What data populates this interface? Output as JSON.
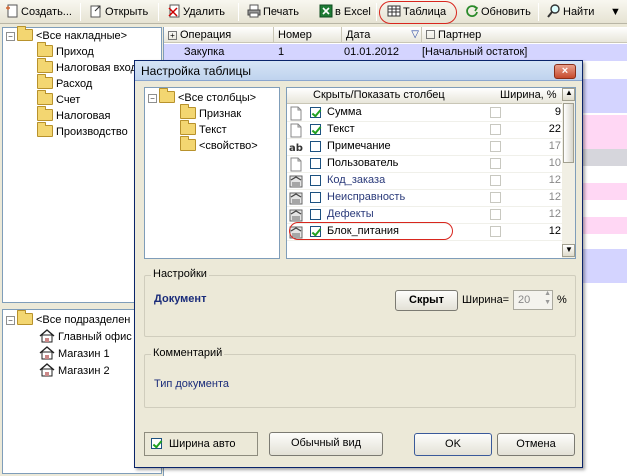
{
  "toolbar": {
    "items": [
      {
        "label": "Создать...",
        "icon": "new-doc-icon"
      },
      {
        "label": "Открыть",
        "icon": "open-icon"
      },
      {
        "label": "Удалить",
        "icon": "delete-icon"
      },
      {
        "label": "Печать",
        "icon": "print-icon"
      },
      {
        "label": "в Excel",
        "icon": "excel-icon"
      },
      {
        "label": "Таблица",
        "icon": "table-icon"
      },
      {
        "label": "Обновить",
        "icon": "refresh-icon"
      },
      {
        "label": "Найти",
        "icon": "find-icon"
      }
    ]
  },
  "left_tree": {
    "root": "<Все накладные>",
    "items": [
      "Приход",
      "Налоговая вход",
      "Расход",
      "Счет",
      "Налоговая",
      "Производство"
    ]
  },
  "dept_tree": {
    "root": "<Все подразделен",
    "items": [
      "Главный офис",
      "Магазин 1",
      "Магазин 2"
    ]
  },
  "grid": {
    "headers": [
      "Операция",
      "Номер",
      "Дата",
      "Партнер"
    ],
    "first_row": [
      "Закупка",
      "1",
      "01.01.2012",
      "[Начальный остаток]"
    ]
  },
  "dialog": {
    "title": "Настройка таблицы",
    "close": "×",
    "tree_root": "<Все столбцы>",
    "tree_items": [
      "Признак",
      "Текст",
      "<свойство>"
    ],
    "columns_header": {
      "show": "Скрыть/Показать столбец",
      "width": "Ширина, %"
    },
    "columns": [
      {
        "name": "Сумма",
        "checked": true,
        "enabled": true,
        "width": "9",
        "icon": "doc-icon"
      },
      {
        "name": "Текст",
        "checked": true,
        "enabled": true,
        "width": "22",
        "icon": "doc-icon"
      },
      {
        "name": "Примечание",
        "checked": false,
        "enabled": true,
        "width": "17",
        "icon": "text-ab-icon"
      },
      {
        "name": "Пользователь",
        "checked": false,
        "enabled": true,
        "width": "10",
        "icon": "doc-icon"
      },
      {
        "name": "Код_заказа",
        "checked": false,
        "enabled": false,
        "width": "12",
        "icon": "property-icon"
      },
      {
        "name": "Неисправность",
        "checked": false,
        "enabled": false,
        "width": "12",
        "icon": "property-icon"
      },
      {
        "name": "Дефекты",
        "checked": false,
        "enabled": false,
        "width": "12",
        "icon": "property-icon"
      },
      {
        "name": "Блок_питания",
        "checked": true,
        "enabled": true,
        "width": "12",
        "icon": "property-icon"
      }
    ],
    "settings": {
      "title": "Настройки",
      "field": "Документ",
      "hide_button": "Скрыт",
      "width_label": "Ширина=",
      "width_value": "20",
      "percent": "%"
    },
    "comment": {
      "title": "Комментарий",
      "text": "Тип документа"
    },
    "auto_width_label": "Ширина авто",
    "normal_view": "Обычный вид",
    "ok": "OK",
    "cancel": "Отмена"
  },
  "colors": {
    "highlight": "#d8261e",
    "pink_row": "#ffd7f4",
    "lavender_row": "#d4d4ff",
    "navy_text": "#1a2c7a"
  }
}
